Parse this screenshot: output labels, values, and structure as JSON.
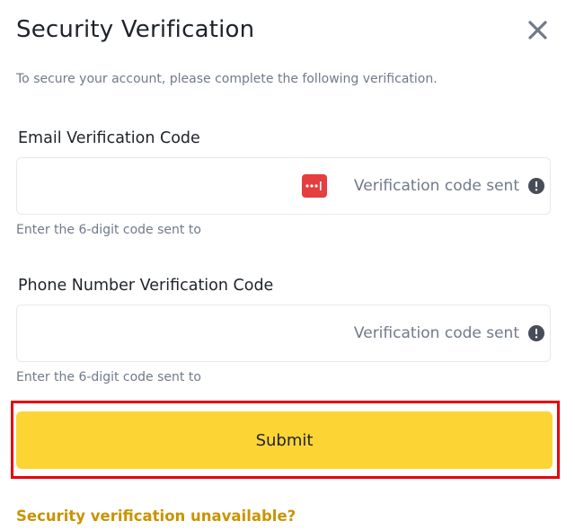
{
  "dialog": {
    "title": "Security Verification",
    "subtitle": "To secure your account, please complete the following verification."
  },
  "email": {
    "label": "Email Verification Code",
    "value": "",
    "placeholder": "",
    "status": "Verification code sent",
    "helper": "Enter the 6-digit code sent to",
    "password_manager_icon": "password-manager-icon",
    "info_icon": "exclamation-circle-icon"
  },
  "phone": {
    "label": "Phone Number Verification Code",
    "value": "",
    "placeholder": "",
    "status": "Verification code sent",
    "helper": "Enter the 6-digit code sent to",
    "info_icon": "exclamation-circle-icon"
  },
  "actions": {
    "submit_label": "Submit",
    "unavailable_link": "Security verification unavailable?"
  },
  "colors": {
    "accent": "#fcd535",
    "link": "#c99400",
    "highlight": "#e8000b",
    "password_icon": "#e53e3e",
    "muted_text": "#707a8a"
  }
}
